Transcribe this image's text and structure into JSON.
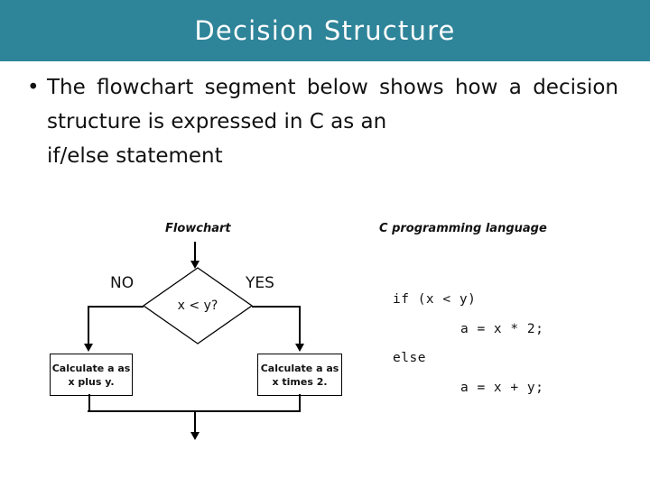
{
  "slide": {
    "title": "Decision Structure",
    "title_bar_color": "#2E8499",
    "title_text_color": "#FFFFFF",
    "background_color": "#FFFFFF"
  },
  "body": {
    "bullet_marker": "•",
    "bullet_line_1": "The flowchart segment below shows how a",
    "bullet_line_2": "decision structure is expressed in C as an",
    "bullet_line_3": "if/else statement",
    "bullet_full_text": "The flowchart segment below shows how a decision structure is expressed in C as an if/else statement"
  },
  "flowchart": {
    "caption": "Flowchart",
    "decision_label": "x < y?",
    "branch_no_label": "NO",
    "branch_yes_label": "YES",
    "box_left": {
      "line1": "Calculate a as",
      "line2": "x plus y."
    },
    "box_right": {
      "line1": "Calculate a as",
      "line2": "x times 2."
    }
  },
  "code_panel": {
    "caption": "C  programming language",
    "line_1": "if (x < y)",
    "line_2": "a = x * 2;",
    "line_3": "else",
    "line_4": "a = x + y;"
  }
}
